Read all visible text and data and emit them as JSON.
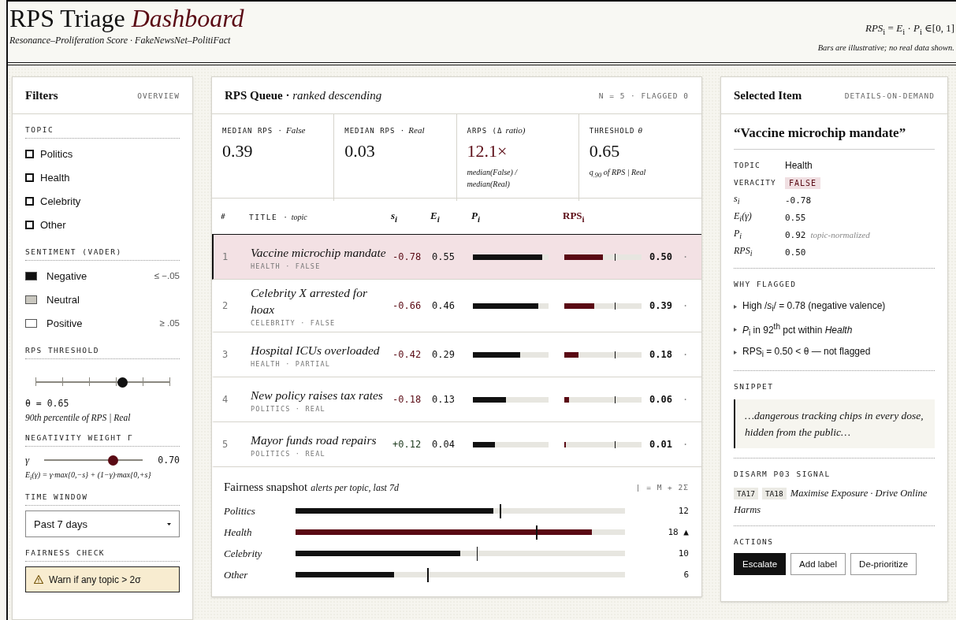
{
  "header": {
    "title": "RPS Triage",
    "title_em": "Dashboard",
    "subtitle": "Resonance–Proliferation Score · FakeNewsNet–PolitiFact",
    "formula": "*RPS*$_{i}$ = *E*$_{i}$ · *P*$_{i}$ ∈[0, 1]",
    "note": "Bars are illustrative; no real data shown."
  },
  "filters": {
    "title": "Filters",
    "tag": "OVERVIEW",
    "topic": {
      "label": "TOPIC",
      "items": [
        {
          "label": "Politics",
          "checked": false
        },
        {
          "label": "Health",
          "checked": false
        },
        {
          "label": "Celebrity",
          "checked": false
        },
        {
          "label": "Other",
          "checked": false
        }
      ]
    },
    "sentiment": {
      "label": "SENTIMENT (VADER)",
      "items": [
        {
          "label": "Negative",
          "color": "#111111",
          "range": "≤ −.05"
        },
        {
          "label": "Neutral",
          "color": "#c9c7bf"
        },
        {
          "label": "Positive",
          "color": "#ffffff",
          "range": "≥ .05"
        }
      ]
    },
    "threshold": {
      "label": "RPS THRESHOLD",
      "level": 0.65,
      "readout": "θ = 0.65",
      "note": "90th percentile of RPS | Real"
    },
    "negativity": {
      "label": "NEGATIVITY WEIGHT Γ",
      "symbol": "γ",
      "level": 0.7,
      "value": "0.70",
      "formula": "E$_{i}$(γ) = γ·max{0,−s} + (1−γ)·max{0,+s}"
    },
    "time_window": {
      "label": "TIME WINDOW",
      "value": "Past 7 days"
    },
    "fairness_check": {
      "label": "FAIRNESS CHECK",
      "warning": "Warn if any topic > 2σ"
    }
  },
  "queue": {
    "title": "RPS Queue ·",
    "title_em": "ranked descending",
    "meta": "N = 5 · FLAGGED 0",
    "stats": [
      {
        "label": "MEDIAN RPS ·",
        "label_em": "False",
        "value": "0.39"
      },
      {
        "label": "MEDIAN RPS ·",
        "label_em": "Real",
        "value": "0.03"
      },
      {
        "label": "ARPS (Δ",
        "label_em": "ratio)",
        "value": "12.1×",
        "note": "median(False) / median(Real)",
        "accent": true
      },
      {
        "label": "THRESHOLD",
        "label_em": "θ",
        "value": "0.65",
        "note": "q$_{.90}$ of RPS | Real"
      }
    ],
    "columns": {
      "rank": "#",
      "title": "TITLE ·",
      "topic": "topic",
      "s": "s$_{i}$",
      "e": "E$_{i}$",
      "p": "P$_{i}$",
      "rps": "RPS$_{i}$"
    },
    "threshold_mark": {
      "level": 0.65
    },
    "rows": [
      {
        "rank": "1",
        "title": "Vaccine microchip mandate",
        "meta": "HEALTH · FALSE",
        "s": "-0.78",
        "kind": "negative",
        "e": "0.55",
        "p_bar": {
          "level": 0.92
        },
        "rps_bar": {
          "level": 0.5
        },
        "rps": "0.50",
        "trail": "·",
        "selected": true
      },
      {
        "rank": "2",
        "title": "Celebrity X arrested for hoax",
        "meta": "CELEBRITY · FALSE",
        "s": "-0.66",
        "kind": "negative",
        "e": "0.46",
        "p_bar": {
          "level": 0.86
        },
        "rps_bar": {
          "level": 0.39
        },
        "rps": "0.39",
        "trail": "·",
        "selected": false
      },
      {
        "rank": "3",
        "title": "Hospital ICUs overloaded",
        "meta": "HEALTH · PARTIAL",
        "s": "-0.42",
        "kind": "negative",
        "e": "0.29",
        "p_bar": {
          "level": 0.62
        },
        "rps_bar": {
          "level": 0.18
        },
        "rps": "0.18",
        "trail": "·",
        "selected": false
      },
      {
        "rank": "4",
        "title": "New policy raises tax rates",
        "meta": "POLITICS · REAL",
        "s": "-0.18",
        "kind": "negative",
        "e": "0.13",
        "p_bar": {
          "level": 0.44
        },
        "rps_bar": {
          "level": 0.06
        },
        "rps": "0.06",
        "trail": "·",
        "selected": false
      },
      {
        "rank": "5",
        "title": "Mayor funds road repairs",
        "meta": "POLITICS · REAL",
        "s": "+0.12",
        "kind": "positive",
        "e": "0.04",
        "p_bar": {
          "level": 0.29
        },
        "rps_bar": {
          "level": 0.01
        },
        "rps": "0.01",
        "trail": "·",
        "selected": false
      }
    ]
  },
  "fairness": {
    "title": "Fairness snapshot",
    "subtitle": "alerts per topic, last 7d",
    "legend": "| = M + 2Σ",
    "rows": [
      {
        "topic": "Politics",
        "bar": {
          "level": 0.6
        },
        "threshold": {
          "level": 0.62
        },
        "count": "12",
        "alert": false
      },
      {
        "topic": "Health",
        "bar": {
          "level": 0.9
        },
        "threshold": {
          "level": 0.73
        },
        "count": "18",
        "flag": "▲",
        "alert": true
      },
      {
        "topic": "Celebrity",
        "bar": {
          "level": 0.5
        },
        "threshold": {
          "level": 0.55
        },
        "count": "10",
        "alert": false
      },
      {
        "topic": "Other",
        "bar": {
          "level": 0.3
        },
        "threshold": {
          "level": 0.4
        },
        "count": "6",
        "alert": false
      }
    ]
  },
  "selected_item": {
    "title": "Selected Item",
    "tag": "DETAILS-ON-DEMAND",
    "quote": "“Vaccine microchip mandate”",
    "fields": [
      {
        "label": "TOPIC",
        "kind": "text",
        "value": "Health"
      },
      {
        "label": "VERACITY",
        "kind": "badge",
        "value": "FALSE"
      },
      {
        "label": "s$_{i}$",
        "kind": "math",
        "value": "-0.78"
      },
      {
        "label": "E$_{i}$(γ)",
        "kind": "math",
        "value": "0.55"
      },
      {
        "label": "P$_{i}$",
        "kind": "math",
        "value": "0.92",
        "note": "topic-normalized"
      },
      {
        "label": "RPS$_{i}$",
        "kind": "math",
        "value": "0.50"
      }
    ],
    "why": {
      "label": "WHY FLAGGED",
      "items": [
        "High /*s*$_{i}$/ = 0.78 (negative valence)",
        "*P*$_{i}$ in 92$^{th}$ pct within *Health*",
        "RPS$_{i}$ = 0.50 < θ — not flagged"
      ]
    },
    "snippet": {
      "label": "SNIPPET",
      "text": "…dangerous tracking chips in every dose, hidden from the public…"
    },
    "disarm": {
      "label": "DISARM P03 SIGNAL",
      "tags": [
        "TA17",
        "TA18"
      ],
      "text": "Maximise Exposure · Drive Online Harms"
    },
    "actions": {
      "label": "ACTIONS",
      "buttons": [
        {
          "label": "Escalate",
          "kind": "primary"
        },
        {
          "label": "Add label",
          "kind": "secondary"
        },
        {
          "label": "De-prioritize",
          "kind": "secondary"
        }
      ]
    }
  }
}
